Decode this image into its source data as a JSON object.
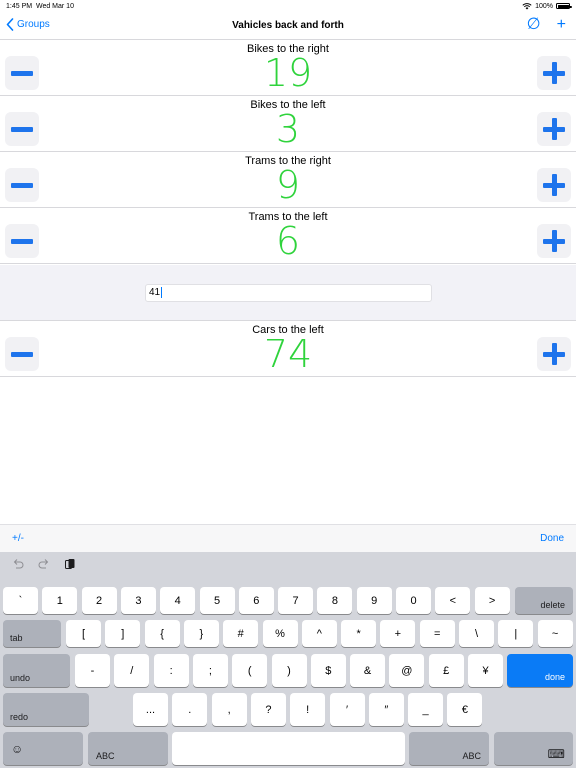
{
  "status": {
    "time": "1:45 PM",
    "date": "Wed Mar 10",
    "battery": "100%"
  },
  "nav": {
    "back_label": "Groups",
    "title": "Vahicles back and forth",
    "clear_icon": "∅",
    "add_icon": "+"
  },
  "counters": [
    {
      "label": "Bikes to the right",
      "value": "19"
    },
    {
      "label": "Bikes to the left",
      "value": "3"
    },
    {
      "label": "Trams to the right",
      "value": "9"
    },
    {
      "label": "Trams to the left",
      "value": "6"
    },
    {
      "label": "Cars to the left",
      "value": "74"
    }
  ],
  "edit": {
    "value": "41"
  },
  "accessory": {
    "left_label": "+/-",
    "right_label": "Done"
  },
  "keyboard": {
    "row1": [
      "`",
      "1",
      "2",
      "3",
      "4",
      "5",
      "6",
      "7",
      "8",
      "9",
      "0",
      "<",
      ">"
    ],
    "delete": "delete",
    "tab": "tab",
    "row2": [
      "[",
      "]",
      "{",
      "}",
      "#",
      "%",
      "^",
      "*",
      "+",
      "=",
      "\\",
      "|",
      "~"
    ],
    "undo": "undo",
    "row3": [
      "-",
      "/",
      ":",
      ";",
      "(",
      ")",
      "$",
      "&",
      "@",
      "£",
      "¥"
    ],
    "done": "done",
    "redo": "redo",
    "row4": [
      "...",
      ".",
      ",",
      "?",
      "!",
      "′",
      "″",
      "_",
      "€"
    ],
    "emoji": "☺",
    "abc_left": "ABC",
    "abc_right": "ABC",
    "keyboard_icon": "⌨"
  },
  "colors": {
    "accent": "#007aff",
    "counter": "#2fd33c",
    "button_glyph": "#1e74ec",
    "done_key": "#0a7bf6"
  }
}
